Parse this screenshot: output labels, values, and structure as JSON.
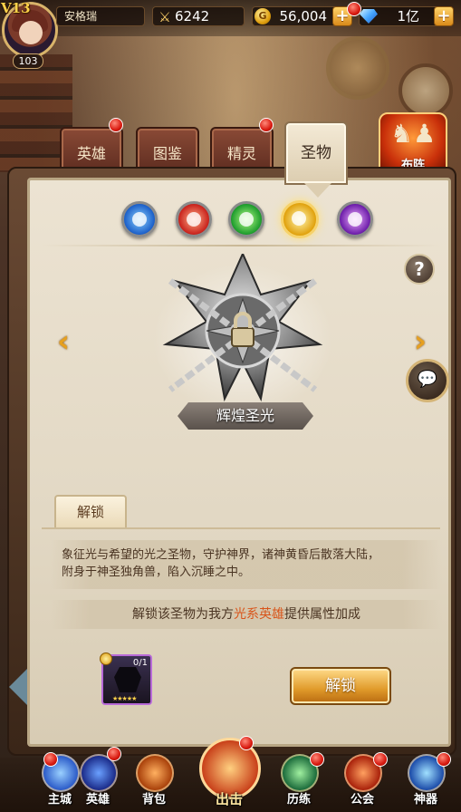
{
  "player": {
    "vip": "V13",
    "level": "103",
    "name": "安格瑞"
  },
  "resources": {
    "power": "6242",
    "gold": "56,004",
    "gems": "1亿",
    "coin_glyph": "G"
  },
  "tabs": [
    {
      "label": "英雄",
      "badge": true
    },
    {
      "label": "图鉴",
      "badge": false
    },
    {
      "label": "精灵",
      "badge": true
    },
    {
      "label": "圣物",
      "badge": false,
      "active": true
    }
  ],
  "formation_button": {
    "label": "布阵",
    "icon": "chess-icon"
  },
  "elements": [
    {
      "name": "water",
      "icon": "water-drop-icon",
      "color": "#1a5ec8"
    },
    {
      "name": "fire",
      "icon": "flame-icon",
      "color": "#c8201a"
    },
    {
      "name": "wind",
      "icon": "tornado-icon",
      "color": "#1a9a2a"
    },
    {
      "name": "light",
      "icon": "sun-icon",
      "color": "#e0a00a",
      "selected": true
    },
    {
      "name": "dark",
      "icon": "dark-orb-icon",
      "color": "#6a1aa8"
    }
  ],
  "relic": {
    "name": "辉煌圣光",
    "locked": true
  },
  "unlock_section": {
    "tab_label": "解锁",
    "description_line1": "象征光与希望的光之圣物，守护神界，诸神黄昏后散落大陆，",
    "description_line2": "附身于神圣独角兽，陷入沉睡之中。",
    "bonus_prefix": "解锁该圣物为我方",
    "bonus_highlight": "光系英雄",
    "bonus_suffix": "提供属性加成",
    "highlight_color": "#d8541a"
  },
  "material": {
    "count": "0/1",
    "stars": "★★★★★"
  },
  "unlock_button": {
    "label": "解锁"
  },
  "help_glyph": "?",
  "arrows": {
    "left": "‹",
    "right": "›"
  },
  "bottom_nav": [
    {
      "label": "主城",
      "icon": "castle-icon",
      "badge": true
    },
    {
      "label": "英雄",
      "icon": "hero-helmet-icon",
      "badge": true
    },
    {
      "label": "背包",
      "icon": "backpack-icon",
      "badge": false
    },
    {
      "label": "出击",
      "icon": "crossed-swords-icon",
      "badge": true
    },
    {
      "label": "历练",
      "icon": "training-icon",
      "badge": true
    },
    {
      "label": "公会",
      "icon": "guild-banner-icon",
      "badge": true
    },
    {
      "label": "神器",
      "icon": "artifact-orb-icon",
      "badge": true
    }
  ]
}
